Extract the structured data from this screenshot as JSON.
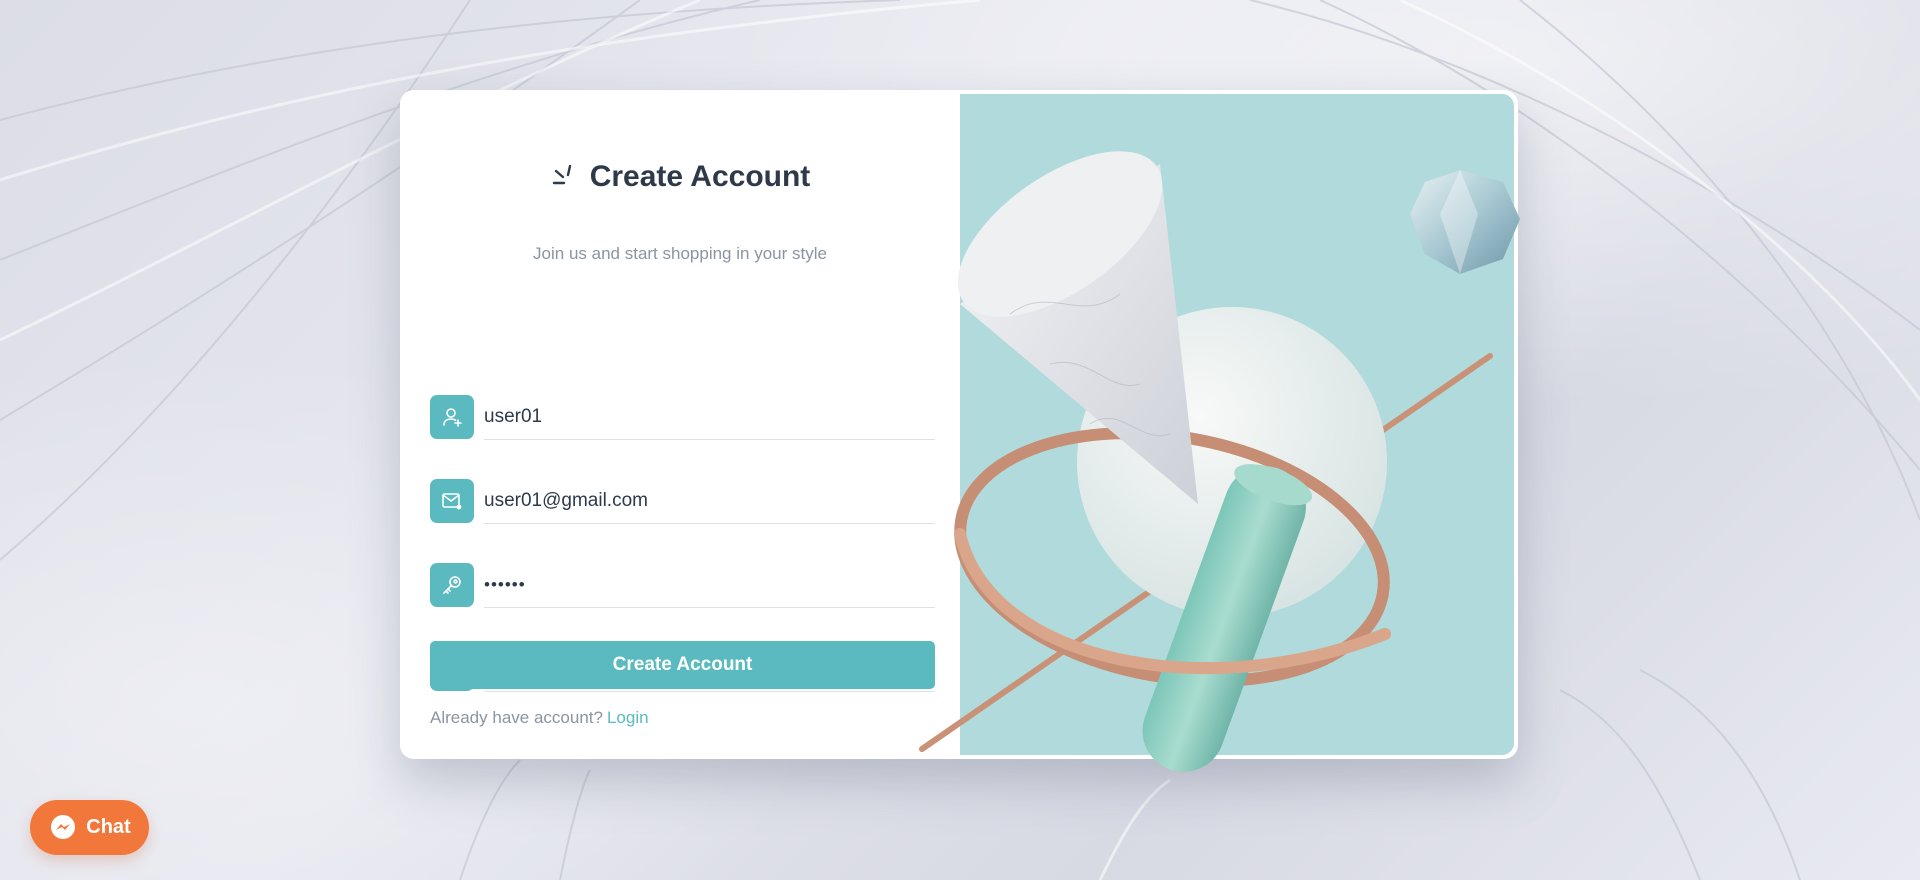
{
  "form": {
    "title": "Create Account",
    "subtitle": "Join us and start shopping in your style",
    "fields": [
      {
        "name": "username",
        "icon": "user-plus-icon",
        "value": "user01",
        "type": "text"
      },
      {
        "name": "email",
        "icon": "mail-icon",
        "value": "user01@gmail.com",
        "type": "email"
      },
      {
        "name": "password",
        "icon": "key-icon",
        "value": "••••••",
        "type": "password"
      },
      {
        "name": "confirm_password",
        "icon": "refresh-icon",
        "value": "••••••",
        "type": "password"
      }
    ],
    "submit_label": "Create Account",
    "login_prompt": "Already have account?",
    "login_link": "Login"
  },
  "chat": {
    "label": "Chat",
    "icon": "messenger-icon"
  },
  "colors": {
    "accent": "#5bbac0",
    "art_background": "#b0dadb",
    "chat_button": "#f2773a",
    "title_text": "#2e3a4a",
    "muted_text": "#8a94a3"
  }
}
